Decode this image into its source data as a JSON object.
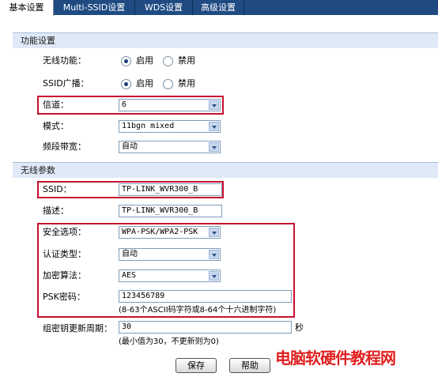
{
  "tabs": [
    {
      "label": "基本设置"
    },
    {
      "label": "Multi-SSID设置"
    },
    {
      "label": "WDS设置"
    },
    {
      "label": "高级设置"
    }
  ],
  "function_section": {
    "title": "功能设置",
    "wireless": {
      "label": "无线功能：",
      "on": "启用",
      "off": "禁用",
      "selected": "启用"
    },
    "ssid_broadcast": {
      "label": "SSID广播：",
      "on": "启用",
      "off": "禁用",
      "selected": "启用"
    },
    "channel": {
      "label": "信道：",
      "value": "6"
    },
    "mode": {
      "label": "模式：",
      "value": "11bgn mixed"
    },
    "bandwidth": {
      "label": "频段带宽：",
      "value": "自动"
    }
  },
  "params_section": {
    "title": "无线参数",
    "ssid": {
      "label": "SSID：",
      "value": "TP-LINK_WVR300_B"
    },
    "description": {
      "label": "描述：",
      "value": "TP-LINK_WVR300_B"
    },
    "security": {
      "label": "安全选项：",
      "value": "WPA-PSK/WPA2-PSK"
    },
    "auth_type": {
      "label": "认证类型：",
      "value": "自动"
    },
    "encryption": {
      "label": "加密算法：",
      "value": "AES"
    },
    "psk": {
      "label": "PSK密码：",
      "value": "123456789",
      "hint": "(8-63个ASCII码字符或8-64个十六进制字符)"
    },
    "group_key": {
      "label": "组密钥更新周期：",
      "value": "30",
      "unit": "秒",
      "hint": "(最小值为30，不更新则为0)"
    }
  },
  "buttons": {
    "save": "保存",
    "help": "帮助"
  },
  "watermark": "电脑软硬件教程网",
  "colors": {
    "tab_bar": "#1f4b82",
    "section_bg": "#dfe9f7",
    "highlight": "#c8102e"
  }
}
